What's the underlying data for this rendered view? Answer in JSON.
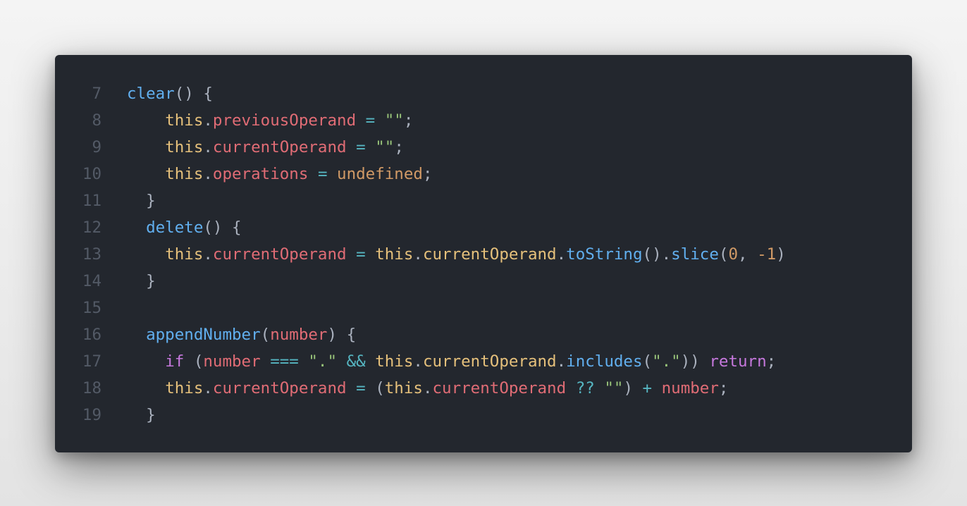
{
  "colors": {
    "background": "#23272e",
    "line_number": "#535a66",
    "plain": "#abb2bf",
    "function": "#61afef",
    "this_keyword": "#e5c07b",
    "property": "#e06c75",
    "operator": "#56b6c2",
    "string": "#98c379",
    "constant": "#d19a66",
    "keyword": "#c678dd"
  },
  "lines": [
    {
      "number": "7",
      "indent": "",
      "tokens": [
        {
          "t": "clear",
          "c": "fn"
        },
        {
          "t": "() {",
          "c": "plain"
        }
      ]
    },
    {
      "number": "8",
      "indent": "    ",
      "tokens": [
        {
          "t": "this",
          "c": "self"
        },
        {
          "t": ".",
          "c": "plain"
        },
        {
          "t": "previousOperand",
          "c": "prop"
        },
        {
          "t": " ",
          "c": "plain"
        },
        {
          "t": "=",
          "c": "op"
        },
        {
          "t": " ",
          "c": "plain"
        },
        {
          "t": "\"\"",
          "c": "str"
        },
        {
          "t": ";",
          "c": "plain"
        }
      ]
    },
    {
      "number": "9",
      "indent": "    ",
      "tokens": [
        {
          "t": "this",
          "c": "self"
        },
        {
          "t": ".",
          "c": "plain"
        },
        {
          "t": "currentOperand",
          "c": "prop"
        },
        {
          "t": " ",
          "c": "plain"
        },
        {
          "t": "=",
          "c": "op"
        },
        {
          "t": " ",
          "c": "plain"
        },
        {
          "t": "\"\"",
          "c": "str"
        },
        {
          "t": ";",
          "c": "plain"
        }
      ]
    },
    {
      "number": "10",
      "indent": "    ",
      "tokens": [
        {
          "t": "this",
          "c": "self"
        },
        {
          "t": ".",
          "c": "plain"
        },
        {
          "t": "operations",
          "c": "prop"
        },
        {
          "t": " ",
          "c": "plain"
        },
        {
          "t": "=",
          "c": "op"
        },
        {
          "t": " ",
          "c": "plain"
        },
        {
          "t": "undefined",
          "c": "const"
        },
        {
          "t": ";",
          "c": "plain"
        }
      ]
    },
    {
      "number": "11",
      "indent": "  ",
      "tokens": [
        {
          "t": "}",
          "c": "plain"
        }
      ]
    },
    {
      "number": "12",
      "indent": "  ",
      "tokens": [
        {
          "t": "delete",
          "c": "fn"
        },
        {
          "t": "() {",
          "c": "plain"
        }
      ]
    },
    {
      "number": "13",
      "indent": "    ",
      "tokens": [
        {
          "t": "this",
          "c": "self"
        },
        {
          "t": ".",
          "c": "plain"
        },
        {
          "t": "currentOperand",
          "c": "prop"
        },
        {
          "t": " ",
          "c": "plain"
        },
        {
          "t": "=",
          "c": "op"
        },
        {
          "t": " ",
          "c": "plain"
        },
        {
          "t": "this",
          "c": "self"
        },
        {
          "t": ".",
          "c": "plain"
        },
        {
          "t": "currentOperand",
          "c": "self"
        },
        {
          "t": ".",
          "c": "plain"
        },
        {
          "t": "toString",
          "c": "fn"
        },
        {
          "t": "().",
          "c": "plain"
        },
        {
          "t": "slice",
          "c": "fn"
        },
        {
          "t": "(",
          "c": "plain"
        },
        {
          "t": "0",
          "c": "num"
        },
        {
          "t": ", ",
          "c": "plain"
        },
        {
          "t": "-1",
          "c": "num"
        },
        {
          "t": ")",
          "c": "plain"
        }
      ]
    },
    {
      "number": "14",
      "indent": "  ",
      "tokens": [
        {
          "t": "}",
          "c": "plain"
        }
      ]
    },
    {
      "number": "15",
      "indent": "",
      "tokens": []
    },
    {
      "number": "16",
      "indent": "  ",
      "tokens": [
        {
          "t": "appendNumber",
          "c": "fn"
        },
        {
          "t": "(",
          "c": "plain"
        },
        {
          "t": "number",
          "c": "prop"
        },
        {
          "t": ") {",
          "c": "plain"
        }
      ]
    },
    {
      "number": "17",
      "indent": "    ",
      "tokens": [
        {
          "t": "if",
          "c": "kw"
        },
        {
          "t": " (",
          "c": "plain"
        },
        {
          "t": "number",
          "c": "prop"
        },
        {
          "t": " ",
          "c": "plain"
        },
        {
          "t": "===",
          "c": "op"
        },
        {
          "t": " ",
          "c": "plain"
        },
        {
          "t": "\".\"",
          "c": "str"
        },
        {
          "t": " ",
          "c": "plain"
        },
        {
          "t": "&&",
          "c": "op"
        },
        {
          "t": " ",
          "c": "plain"
        },
        {
          "t": "this",
          "c": "self"
        },
        {
          "t": ".",
          "c": "plain"
        },
        {
          "t": "currentOperand",
          "c": "self"
        },
        {
          "t": ".",
          "c": "plain"
        },
        {
          "t": "includes",
          "c": "fn"
        },
        {
          "t": "(",
          "c": "plain"
        },
        {
          "t": "\".\"",
          "c": "str"
        },
        {
          "t": ")) ",
          "c": "plain"
        },
        {
          "t": "return",
          "c": "kw"
        },
        {
          "t": ";",
          "c": "plain"
        }
      ]
    },
    {
      "number": "18",
      "indent": "    ",
      "tokens": [
        {
          "t": "this",
          "c": "self"
        },
        {
          "t": ".",
          "c": "plain"
        },
        {
          "t": "currentOperand",
          "c": "prop"
        },
        {
          "t": " ",
          "c": "plain"
        },
        {
          "t": "=",
          "c": "op"
        },
        {
          "t": " (",
          "c": "plain"
        },
        {
          "t": "this",
          "c": "self"
        },
        {
          "t": ".",
          "c": "plain"
        },
        {
          "t": "currentOperand",
          "c": "prop"
        },
        {
          "t": " ",
          "c": "plain"
        },
        {
          "t": "??",
          "c": "op"
        },
        {
          "t": " ",
          "c": "plain"
        },
        {
          "t": "\"\"",
          "c": "str"
        },
        {
          "t": ") ",
          "c": "plain"
        },
        {
          "t": "+",
          "c": "op"
        },
        {
          "t": " ",
          "c": "plain"
        },
        {
          "t": "number",
          "c": "prop"
        },
        {
          "t": ";",
          "c": "plain"
        }
      ]
    },
    {
      "number": "19",
      "indent": "  ",
      "tokens": [
        {
          "t": "}",
          "c": "plain"
        }
      ]
    }
  ]
}
